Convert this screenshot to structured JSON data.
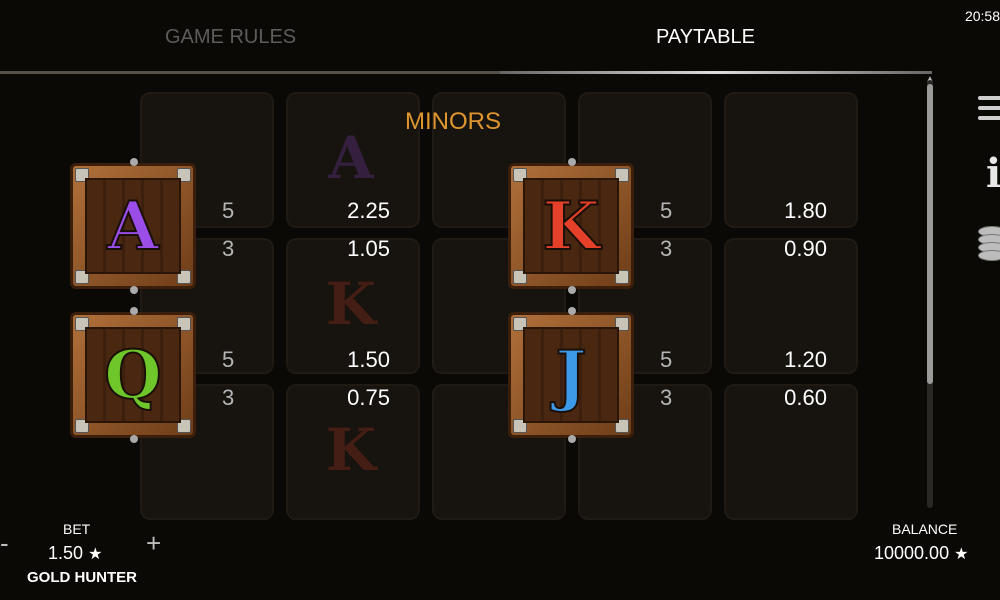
{
  "clock": "20:58",
  "tabs": {
    "rules": "GAME RULES",
    "paytable": "PAYTABLE"
  },
  "section_title": "MINORS",
  "symbols": [
    {
      "letter": "A",
      "color": "#9b4de8",
      "pays": [
        {
          "count": "5",
          "value": "2.25"
        },
        {
          "count": "3",
          "value": "1.05"
        }
      ]
    },
    {
      "letter": "K",
      "color": "#e4402a",
      "pays": [
        {
          "count": "5",
          "value": "1.80"
        },
        {
          "count": "3",
          "value": "0.90"
        }
      ]
    },
    {
      "letter": "Q",
      "color": "#6ec62a",
      "pays": [
        {
          "count": "5",
          "value": "1.50"
        },
        {
          "count": "3",
          "value": "0.75"
        }
      ]
    },
    {
      "letter": "J",
      "color": "#3d9ae8",
      "pays": [
        {
          "count": "5",
          "value": "1.20"
        },
        {
          "count": "3",
          "value": "0.60"
        }
      ]
    }
  ],
  "footer": {
    "bet_label": "BET",
    "bet_value": "1.50",
    "game_name": "GOLD HUNTER",
    "balance_label": "BALANCE",
    "balance_value": "10000.00",
    "currency_icon": "star-icon",
    "minus": "-",
    "plus": "+"
  },
  "side_icons": [
    "menu-icon",
    "info-icon",
    "coins-icon"
  ]
}
